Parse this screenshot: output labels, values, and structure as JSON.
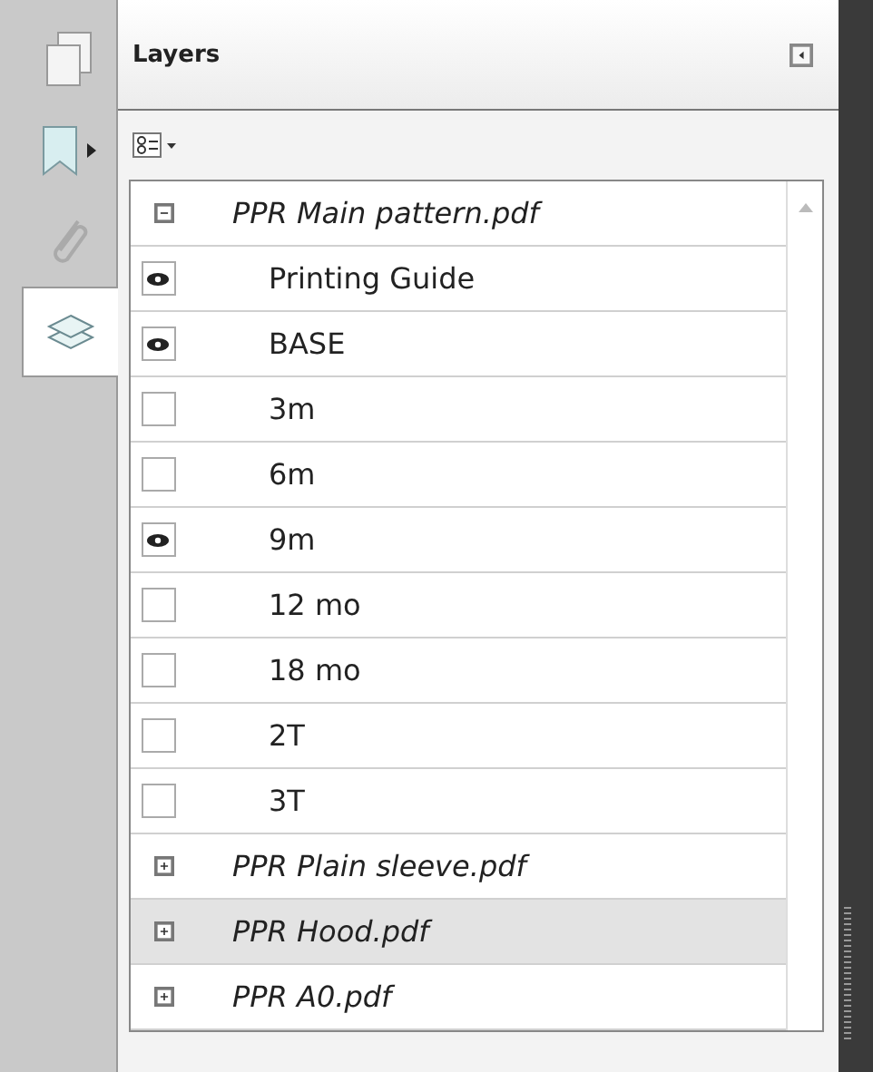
{
  "side_tabs": [
    {
      "kind": "pages",
      "selected": false
    },
    {
      "kind": "bookmarks",
      "selected": false
    },
    {
      "kind": "attachments",
      "selected": false
    },
    {
      "kind": "layers",
      "selected": true
    }
  ],
  "panel": {
    "title": "Layers"
  },
  "tree": [
    {
      "label": "PPR Main pattern.pdf",
      "expanded": true,
      "selected": false,
      "children": [
        {
          "label": "Printing Guide",
          "visible": true
        },
        {
          "label": "BASE",
          "visible": true
        },
        {
          "label": "3m",
          "visible": false
        },
        {
          "label": "6m",
          "visible": false
        },
        {
          "label": "9m",
          "visible": true
        },
        {
          "label": "12 mo",
          "visible": false
        },
        {
          "label": "18 mo",
          "visible": false
        },
        {
          "label": "2T",
          "visible": false
        },
        {
          "label": "3T",
          "visible": false
        }
      ]
    },
    {
      "label": "PPR Plain sleeve.pdf",
      "expanded": false,
      "selected": false
    },
    {
      "label": "PPR Hood.pdf",
      "expanded": false,
      "selected": true
    },
    {
      "label": "PPR A0.pdf",
      "expanded": false,
      "selected": false
    }
  ]
}
